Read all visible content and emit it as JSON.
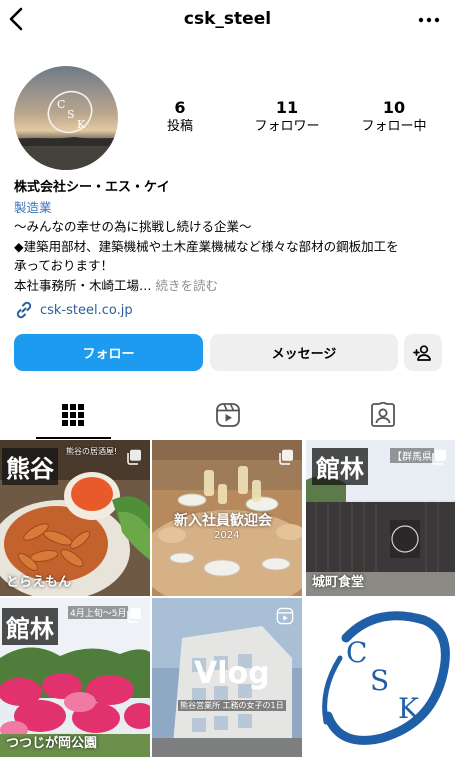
{
  "header": {
    "username": "csk_steel"
  },
  "profile": {
    "avatar_text": "CSK",
    "stats": [
      {
        "value": "6",
        "label": "投稿"
      },
      {
        "value": "11",
        "label": "フォロワー"
      },
      {
        "value": "10",
        "label": "フォロー中"
      }
    ],
    "name": "株式会社シー・エス・ケイ",
    "category": "製造業",
    "bio_lines": [
      "〜みんなの幸せの為に挑戦し続ける企業〜",
      "◆建築用部材、建築機械や土木産業機械など様々な部材の鋼板加工を",
      "承っております！",
      "本社事務所・木崎工場…"
    ],
    "more_label": "続きを読む",
    "link": "csk-steel.co.jp"
  },
  "actions": {
    "follow": "フォロー",
    "message": "メッセージ"
  },
  "tabs": [
    "grid-icon",
    "reels-icon",
    "tagged-icon"
  ],
  "posts": [
    {
      "tag": "熊谷",
      "caption": "とらえもん",
      "note": "熊谷の居酒屋!"
    },
    {
      "title": "新入社員歓迎会",
      "year": "2024"
    },
    {
      "tag": "館林",
      "caption": "城町食堂",
      "note": "【群馬県"
    },
    {
      "tag": "館林",
      "caption": "つつじが岡公園",
      "note": "4月上旬〜5月"
    },
    {
      "title": "Vlog",
      "subtitle": "熊谷営業所 工務の女子の1日"
    },
    {
      "logo": "CSK"
    }
  ],
  "colors": {
    "follow_button": "#1d9bf0",
    "secondary_button": "#efefef",
    "link": "#2b5e9e",
    "logo_blue": "#1f5fa8"
  }
}
